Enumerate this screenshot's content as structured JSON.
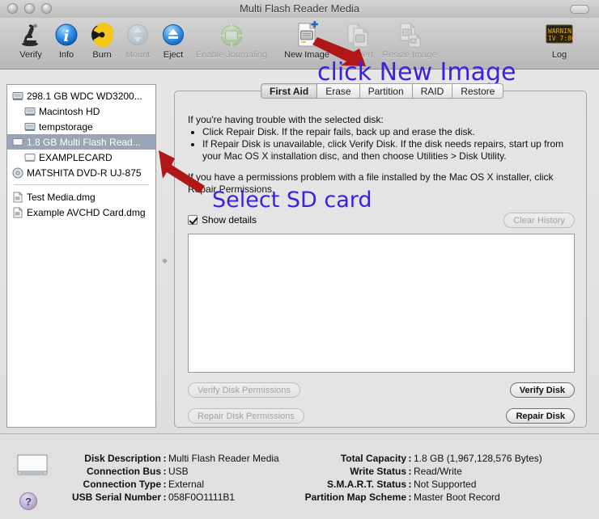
{
  "window": {
    "title": "Multi Flash Reader Media",
    "traffic_lights": [
      "close-button",
      "minimize-button",
      "zoom-button"
    ]
  },
  "toolbar": {
    "items": [
      {
        "label": "Verify",
        "icon": "microscope-icon",
        "enabled": true
      },
      {
        "label": "Info",
        "icon": "info-icon",
        "enabled": true
      },
      {
        "label": "Burn",
        "icon": "burn-radioactive-icon",
        "enabled": true
      },
      {
        "label": "Mount",
        "icon": "mount-icon",
        "enabled": false
      },
      {
        "label": "Eject",
        "icon": "eject-icon",
        "enabled": true
      },
      {
        "label": "Enable Journaling",
        "icon": "journaling-disk-icon",
        "enabled": false
      },
      {
        "label": "New Image",
        "icon": "new-image-icon",
        "enabled": true
      },
      {
        "label": "Convert",
        "icon": "convert-icon",
        "enabled": false
      },
      {
        "label": "Resize Image",
        "icon": "resize-image-icon",
        "enabled": false
      },
      {
        "label": "Log",
        "icon": "log-icon",
        "enabled": true
      }
    ]
  },
  "sidebar": {
    "items": [
      {
        "label": "298.1 GB WDC WD3200...",
        "icon": "hard-disk-icon",
        "indent": false,
        "selected": false
      },
      {
        "label": "Macintosh HD",
        "icon": "volume-icon",
        "indent": true,
        "selected": false
      },
      {
        "label": "tempstorage",
        "icon": "volume-icon",
        "indent": true,
        "selected": false
      },
      {
        "label": "1.8 GB Multi Flash Read...",
        "icon": "removable-disk-icon",
        "indent": false,
        "selected": true
      },
      {
        "label": "EXAMPLECARD",
        "icon": "removable-volume-icon",
        "indent": true,
        "selected": false
      },
      {
        "label": "MATSHITA DVD-R UJ-875",
        "icon": "optical-disc-icon",
        "indent": false,
        "selected": false
      }
    ],
    "images": [
      {
        "label": "Test Media.dmg",
        "icon": "disk-image-icon",
        "indent": false,
        "selected": false
      },
      {
        "label": "Example AVCHD Card.dmg",
        "icon": "disk-image-icon",
        "indent": false,
        "selected": false
      }
    ]
  },
  "tabs": [
    {
      "label": "First Aid",
      "active": true
    },
    {
      "label": "Erase",
      "active": false
    },
    {
      "label": "Partition",
      "active": false
    },
    {
      "label": "RAID",
      "active": false
    },
    {
      "label": "Restore",
      "active": false
    }
  ],
  "first_aid": {
    "intro": "If you're having trouble with the selected disk:",
    "bullets": [
      "Click Repair Disk. If the repair fails, back up and erase the disk.",
      "If Repair Disk is unavailable, click Verify Disk. If the disk needs repairs, start up from your Mac OS X installation disc, and then choose Utilities > Disk Utility."
    ],
    "permissions_note": "If you have a permissions problem with a file installed by the Mac OS X installer, click Repair Permissions.",
    "show_details_label": "Show details",
    "show_details_checked": true,
    "clear_history_label": "Clear History",
    "log_contents": "",
    "buttons": {
      "verify_permissions": "Verify Disk Permissions",
      "repair_permissions": "Repair Disk Permissions",
      "verify_disk": "Verify Disk",
      "repair_disk": "Repair Disk"
    }
  },
  "info": {
    "left": [
      {
        "label": "Disk Description",
        "value": "Multi Flash Reader Media"
      },
      {
        "label": "Connection Bus",
        "value": "USB"
      },
      {
        "label": "Connection Type",
        "value": "External"
      },
      {
        "label": "USB Serial Number",
        "value": "058F0O1111B1"
      }
    ],
    "right": [
      {
        "label": "Total Capacity",
        "value": "1.8 GB (1,967,128,576 Bytes)"
      },
      {
        "label": "Write Status",
        "value": "Read/Write"
      },
      {
        "label": "S.M.A.R.T. Status",
        "value": "Not Supported"
      },
      {
        "label": "Partition Map Scheme",
        "value": "Master Boot Record"
      }
    ],
    "help_glyph": "?"
  },
  "annotations": [
    {
      "text": "click New Image",
      "color": "#3f20e0",
      "target": "new-image-toolbar-button"
    },
    {
      "text": "Select SD card",
      "color": "#3f20e0",
      "target": "sidebar-item-multi-flash-reader"
    }
  ],
  "colors": {
    "arrow": "#b01818",
    "annotation_text": "#3f20e0",
    "selection": "#9aa4b4"
  }
}
